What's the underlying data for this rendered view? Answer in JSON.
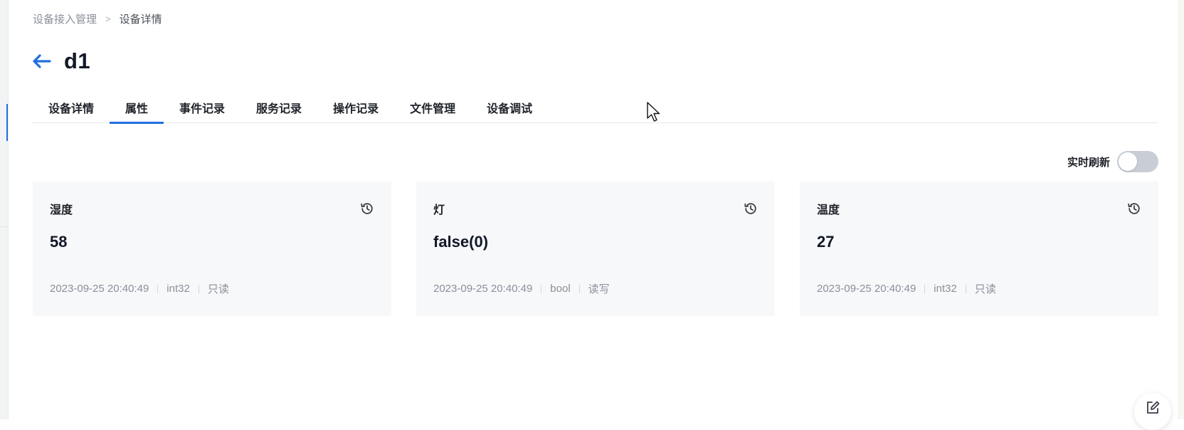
{
  "breadcrumb": {
    "parent": "设备接入管理",
    "separator": ">",
    "current": "设备详情"
  },
  "page": {
    "title": "d1"
  },
  "tabs": [
    {
      "label": "设备详情",
      "active": false
    },
    {
      "label": "属性",
      "active": true
    },
    {
      "label": "事件记录",
      "active": false
    },
    {
      "label": "服务记录",
      "active": false
    },
    {
      "label": "操作记录",
      "active": false
    },
    {
      "label": "文件管理",
      "active": false
    },
    {
      "label": "设备调试",
      "active": false
    }
  ],
  "refresh": {
    "label": "实时刷新",
    "enabled": false
  },
  "properties": [
    {
      "name": "湿度",
      "value": "58",
      "timestamp": "2023-09-25 20:40:49",
      "type": "int32",
      "access": "只读"
    },
    {
      "name": "灯",
      "value": "false(0)",
      "timestamp": "2023-09-25 20:40:49",
      "type": "bool",
      "access": "读写"
    },
    {
      "name": "温度",
      "value": "27",
      "timestamp": "2023-09-25 20:40:49",
      "type": "int32",
      "access": "只读"
    }
  ],
  "icons": {
    "back": "arrow-left-icon",
    "history": "history-icon",
    "edit": "edit-icon"
  },
  "colors": {
    "accent": "#1f6fe0",
    "card_bg": "#f7f8fa",
    "toggle_off": "#c9ced6"
  }
}
